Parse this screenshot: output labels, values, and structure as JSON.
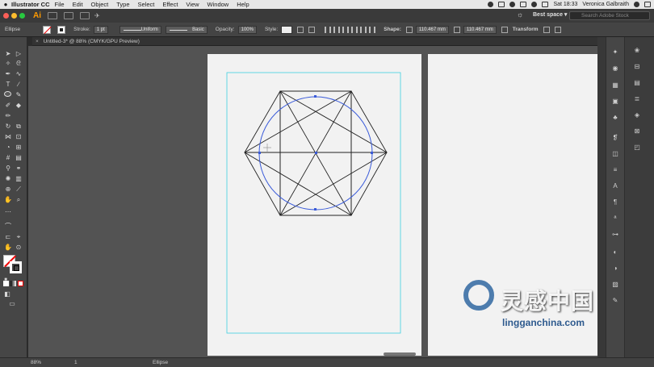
{
  "menubar": {
    "apple": "",
    "app_name": "Illustrator CC",
    "items": [
      "File",
      "Edit",
      "Object",
      "Type",
      "Select",
      "Effect",
      "View",
      "Window",
      "Help"
    ],
    "clock": "Sat 18:33",
    "user": "Veronica Galbraith"
  },
  "appbar": {
    "logo": "Ai",
    "workspace": "Best space ▾",
    "search_placeholder": "Search Adobe Stock"
  },
  "control": {
    "object_type": "Ellipse",
    "stroke_label": "Stroke:",
    "stroke_value": "1 pt",
    "profile_uniform": "Uniform",
    "brush_basic": "Basic",
    "opacity_label": "Opacity:",
    "opacity_value": "100%",
    "style_label": "Style:",
    "shape_label": "Shape:",
    "width_value": "110.467 mm",
    "height_value": "110.467 mm",
    "transform_label": "Transform"
  },
  "document": {
    "tab_title": "Untitled-3* @ 88% (CMYK/GPU Preview)",
    "close": "×"
  },
  "status": {
    "zoom": "88%",
    "page": "1",
    "selection_tool": "Ellipse"
  },
  "watermark": {
    "chinese": "灵感中国",
    "url": "lingganchina.com"
  },
  "colors": {
    "menubar_bg": "#e6e6e6",
    "ui_dark": "#464646",
    "canvas_bg": "#535353",
    "artboard_bg": "#f2f2f2",
    "guide_cyan": "#3fd0e0",
    "selection_blue": "#3a5bd9",
    "ai_orange": "#ff9a00"
  }
}
